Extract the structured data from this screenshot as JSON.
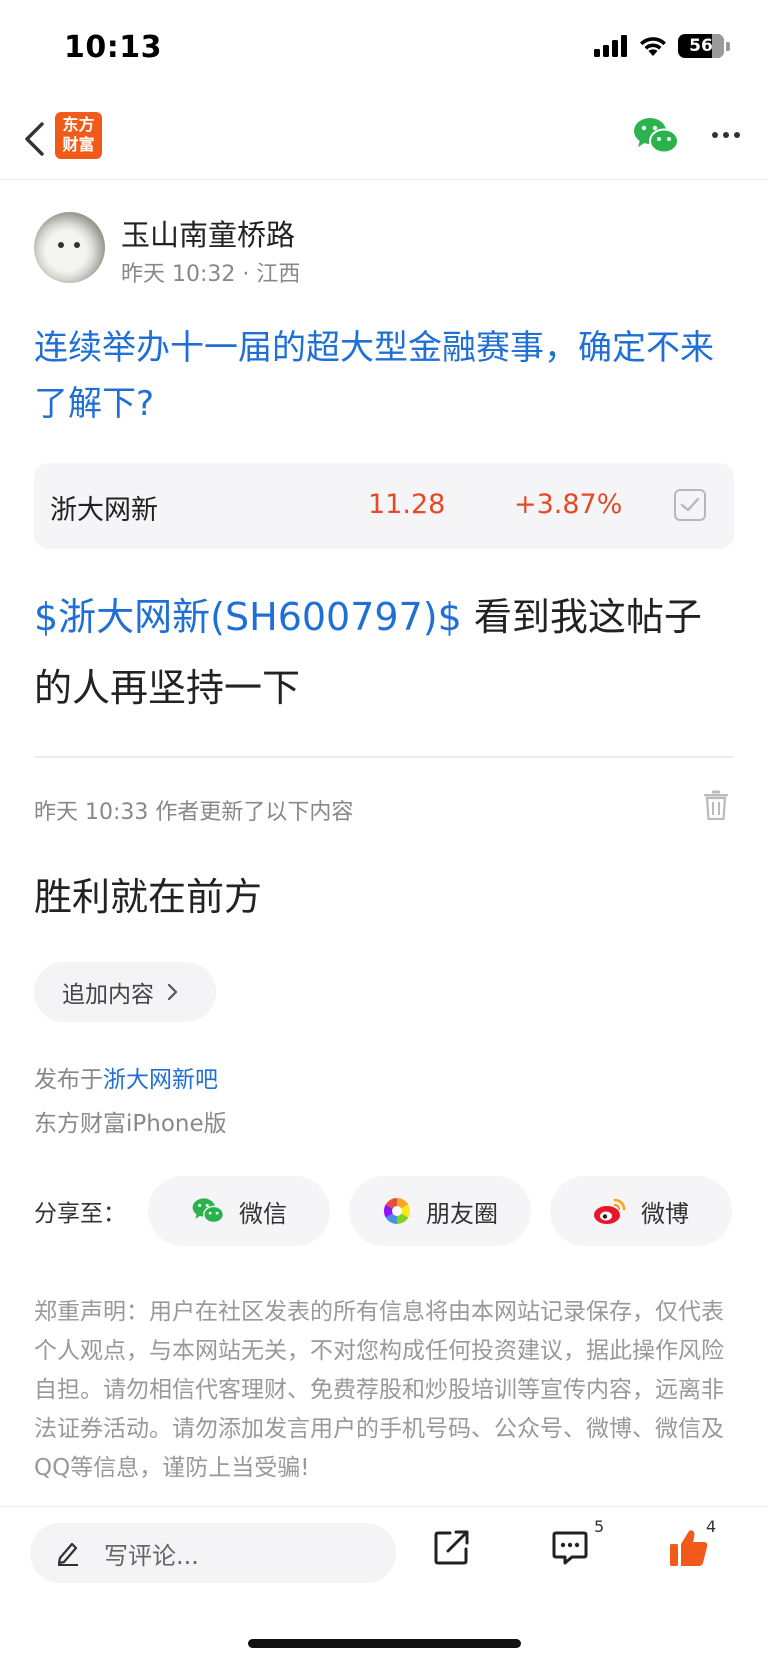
{
  "status_bar": {
    "time": "10:13",
    "battery": "56",
    "icons": [
      "signal-icon",
      "wifi-icon",
      "battery-icon"
    ]
  },
  "nav": {
    "logo_text": "东方财富",
    "icons": [
      "back-icon",
      "wechat-icon",
      "more-icon"
    ]
  },
  "author": {
    "name": "玉山南童桥路",
    "meta": "昨天 10:32 · 江西"
  },
  "post": {
    "title": "连续举办十一届的超大型金融赛事，确定不来了解下?",
    "stock": {
      "name": "浙大网新",
      "price": "11.28",
      "change": "+3.87%"
    },
    "body_tag": "$浙大网新(SH600797)$",
    "body_text": " 看到我这帖子的人再坚持一下"
  },
  "update": {
    "meta": "昨天 10:33  作者更新了以下内容",
    "text": "胜利就在前方",
    "append_label": "追加内容"
  },
  "published": {
    "prefix": "发布于",
    "bar": "浙大网新吧",
    "platform": "东方财富iPhone版"
  },
  "share": {
    "label": "分享至：",
    "wechat": "微信",
    "moments": "朋友圈",
    "weibo": "微博"
  },
  "disclaimer": "郑重声明：用户在社区发表的所有信息将由本网站记录保存，仅代表个人观点，与本网站无关，不对您构成任何投资建议，据此操作风险自担。请勿相信代客理财、免费荐股和炒股培训等宣传内容，远离非法证券活动。请勿添加发言用户的手机号码、公众号、微博、微信及QQ等信息，谨防上当受骗!",
  "bottom_bar": {
    "comment_placeholder": "写评论...",
    "comment_count": "5",
    "like_count": "4"
  },
  "colors": {
    "link_blue": "#1f6fd6",
    "rise_red": "#e54a24",
    "brand_orange": "#f25a19"
  }
}
